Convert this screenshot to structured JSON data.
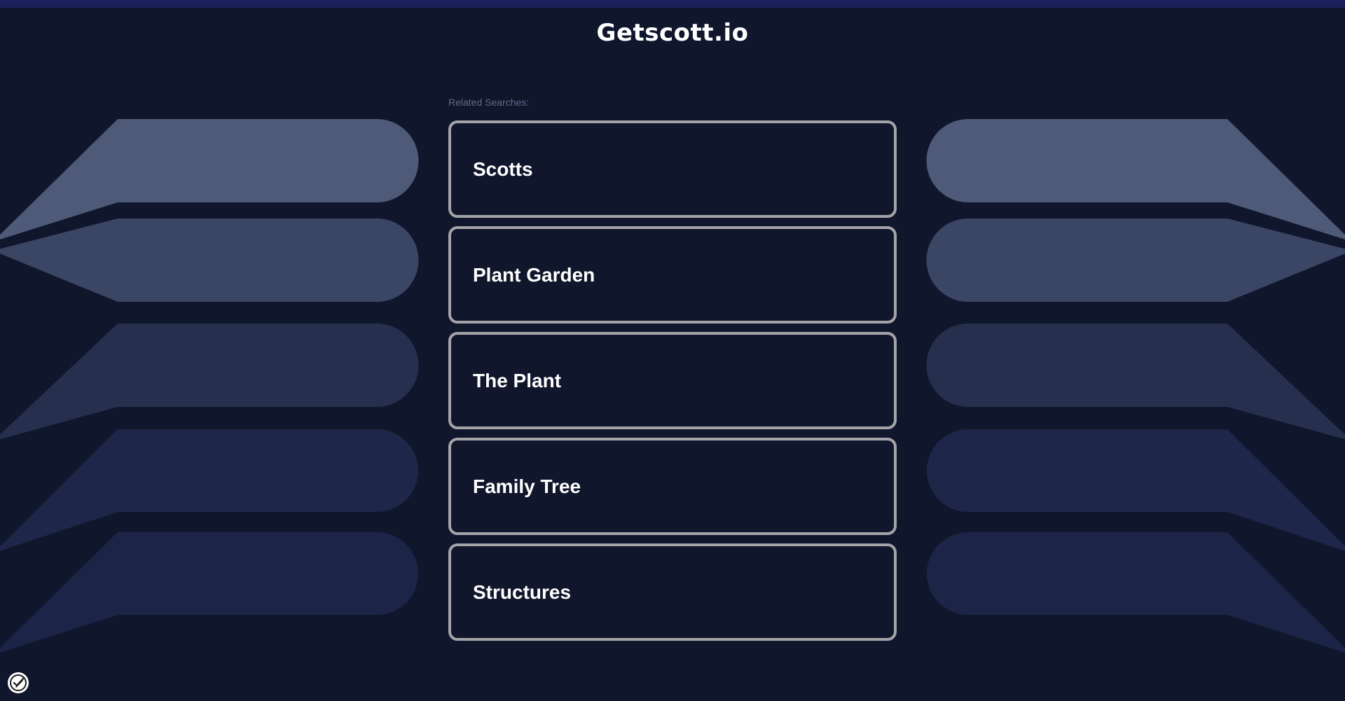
{
  "site": {
    "title": "Getscott.io"
  },
  "related": {
    "label": "Related Searches:",
    "items": [
      {
        "label": "Scotts"
      },
      {
        "label": "Plant Garden"
      },
      {
        "label": "The Plant"
      },
      {
        "label": "Family Tree"
      },
      {
        "label": "Structures"
      }
    ]
  },
  "colors": {
    "background": "#10172c",
    "top_bar": "#1b1f5c",
    "link_border": "#a3a3a8",
    "shape_tones": [
      "#4e5a78",
      "#3b4665",
      "#26304e",
      "#1e2749",
      "#1c2548"
    ]
  },
  "icons": {
    "privacy": "privacy-check-icon"
  }
}
